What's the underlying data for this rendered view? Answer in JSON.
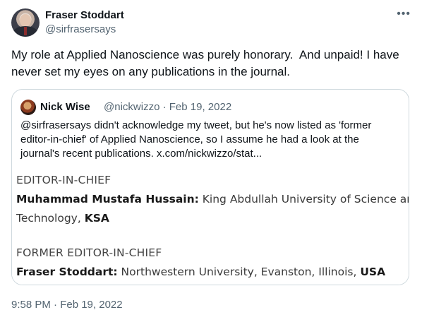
{
  "tweet": {
    "author_name": "Fraser Stoddart",
    "author_handle": "@sirfrasersays",
    "more_icon": "•••",
    "text_line1": "My role at Applied Nanoscience was purely honorary.  And unpaid! I have",
    "text_line2": "never set my eyes on any publications in the journal.",
    "timestamp": "9:58 PM · Feb 19, 2022"
  },
  "quote": {
    "author_name": "Nick Wise",
    "author_handle": "@nickwizzo",
    "separator": "·",
    "date": "Feb 19, 2022",
    "text_line1": "@sirfrasersays didn't acknowledge my tweet, but he's now listed as 'former",
    "text_line2": "editor-in-chief' of Applied Nanoscience, so I assume he had a look at the",
    "text_line3": "journal's recent publications.  x.com/nickwizzo/stat..."
  },
  "card": {
    "heading1": "EDITOR-IN-CHIEF",
    "person1_name": "Muhammad Mustafa Hussain:",
    "person1_affil_a": " King Abdullah University of Science and",
    "person1_affil_b": "Technology, ",
    "person1_country": "KSA",
    "heading2": "FORMER EDITOR-IN-CHIEF",
    "person2_name": "Fraser Stoddart:",
    "person2_affil": " Northwestern University, Evanston, Illinois, ",
    "person2_country": "USA"
  }
}
